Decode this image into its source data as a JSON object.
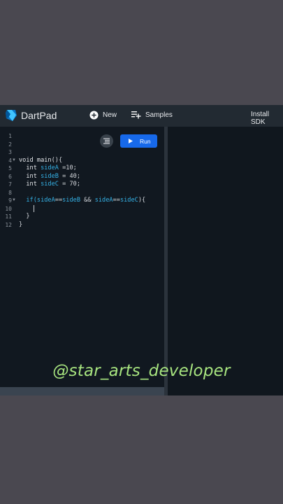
{
  "header": {
    "app_title": "DartPad",
    "new_label": "New",
    "samples_label": "Samples",
    "install_label": "Install SDK"
  },
  "editor": {
    "run_label": "Run",
    "line_numbers": [
      "1",
      "2",
      "3",
      "4",
      "5",
      "6",
      "7",
      "8",
      "9",
      "10",
      "11",
      "12"
    ],
    "code": {
      "l4_void": "void",
      "l4_main": "main",
      "l4_rest": "(){",
      "l5_type": "int",
      "l5_var": "sideA",
      "l5_rest": " =10;",
      "l6_type": "int",
      "l6_var": "sideB",
      "l6_rest": " = 40;",
      "l7_type": "int",
      "l7_var": "sideC",
      "l7_rest": " = 70;",
      "l9_if": "if(",
      "l9_a": "sideA",
      "l9_eq1": "==",
      "l9_b": "sideB",
      "l9_and": " && ",
      "l9_a2": "sideA",
      "l9_eq2": "==",
      "l9_c": "sideC",
      "l9_rest": "){",
      "l11": "}",
      "l12": "}"
    }
  },
  "watermark": "@star_arts_developer",
  "colors": {
    "accent_run": "#1769ea",
    "variable": "#35b3e8",
    "watermark": "#a7e47f"
  },
  "icons": [
    "dart-logo-icon",
    "add-circle-icon",
    "playlist-add-icon",
    "format-icon",
    "play-icon",
    "fold-arrow-icon"
  ]
}
